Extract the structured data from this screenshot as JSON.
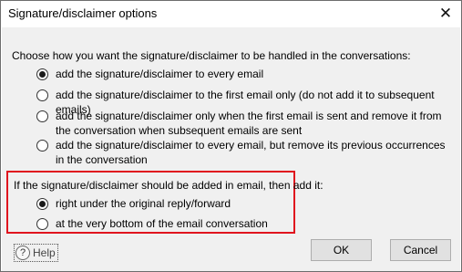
{
  "window": {
    "title": "Signature/disclaimer options",
    "close_glyph": "✕"
  },
  "main": {
    "prompt": "Choose how you want the signature/disclaimer to be handled in the conversations:",
    "options": [
      {
        "label": "add the signature/disclaimer to every email",
        "checked": true
      },
      {
        "label": "add the signature/disclaimer to the first email only (do not add it to subsequent emails)",
        "checked": false
      },
      {
        "label": "add the signature/disclaimer only when the first email is sent and remove it from the conversation when subsequent emails are sent",
        "checked": false
      },
      {
        "label": "add the signature/disclaimer to every email, but remove its previous occurrences in the conversation",
        "checked": false
      }
    ]
  },
  "placement": {
    "prompt": "If the signature/disclaimer should be added in email, then add it:",
    "options": [
      {
        "label": "right under the original reply/forward",
        "checked": true
      },
      {
        "label": "at the very bottom of the email conversation",
        "checked": false
      }
    ],
    "highlight_color": "#e0141e"
  },
  "footer": {
    "help_label": "Help",
    "help_icon": "question-circle-icon",
    "ok_label": "OK",
    "cancel_label": "Cancel"
  }
}
